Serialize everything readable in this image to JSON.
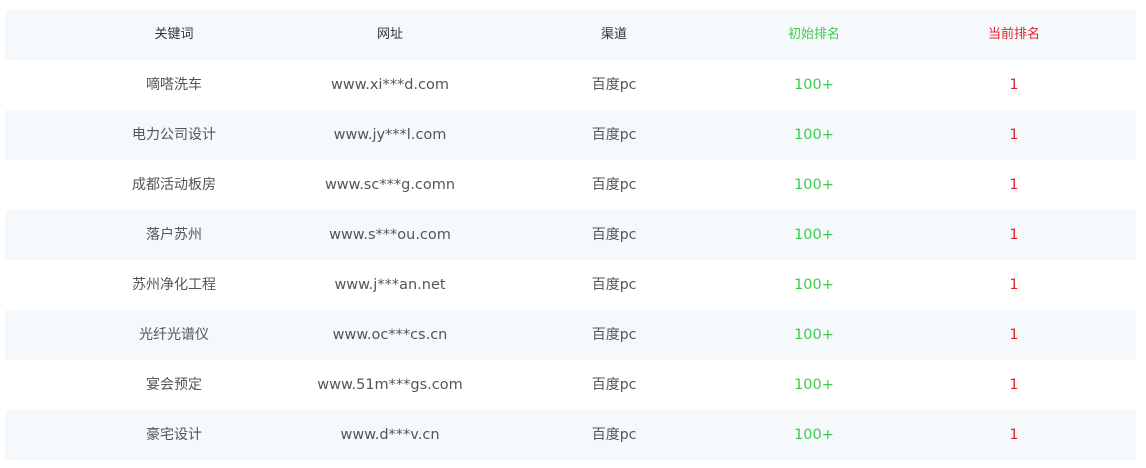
{
  "colors": {
    "initial_rank": "#3dcc4a",
    "current_rank": "#e5202b",
    "stripe": "#f5f9fc"
  },
  "header": {
    "keyword": "关键词",
    "url": "网址",
    "channel": "渠道",
    "initial_rank": "初始排名",
    "current_rank": "当前排名"
  },
  "rows": [
    {
      "keyword": "嘀嗒洗车",
      "url": "www.xi***d.com",
      "channel": "百度pc",
      "initial_rank": "100+",
      "current_rank": "1"
    },
    {
      "keyword": "电力公司设计",
      "url": "www.jy***l.com",
      "channel": "百度pc",
      "initial_rank": "100+",
      "current_rank": "1"
    },
    {
      "keyword": "成都活动板房",
      "url": "www.sc***g.comn",
      "channel": "百度pc",
      "initial_rank": "100+",
      "current_rank": "1"
    },
    {
      "keyword": "落户苏州",
      "url": "www.s***ou.com",
      "channel": "百度pc",
      "initial_rank": "100+",
      "current_rank": "1"
    },
    {
      "keyword": "苏州净化工程",
      "url": "www.j***an.net",
      "channel": "百度pc",
      "initial_rank": "100+",
      "current_rank": "1"
    },
    {
      "keyword": "光纤光谱仪",
      "url": "www.oc***cs.cn",
      "channel": "百度pc",
      "initial_rank": "100+",
      "current_rank": "1"
    },
    {
      "keyword": "宴会预定",
      "url": "www.51m***gs.com",
      "channel": "百度pc",
      "initial_rank": "100+",
      "current_rank": "1"
    },
    {
      "keyword": "豪宅设计",
      "url": "www.d***v.cn",
      "channel": "百度pc",
      "initial_rank": "100+",
      "current_rank": "1"
    }
  ]
}
